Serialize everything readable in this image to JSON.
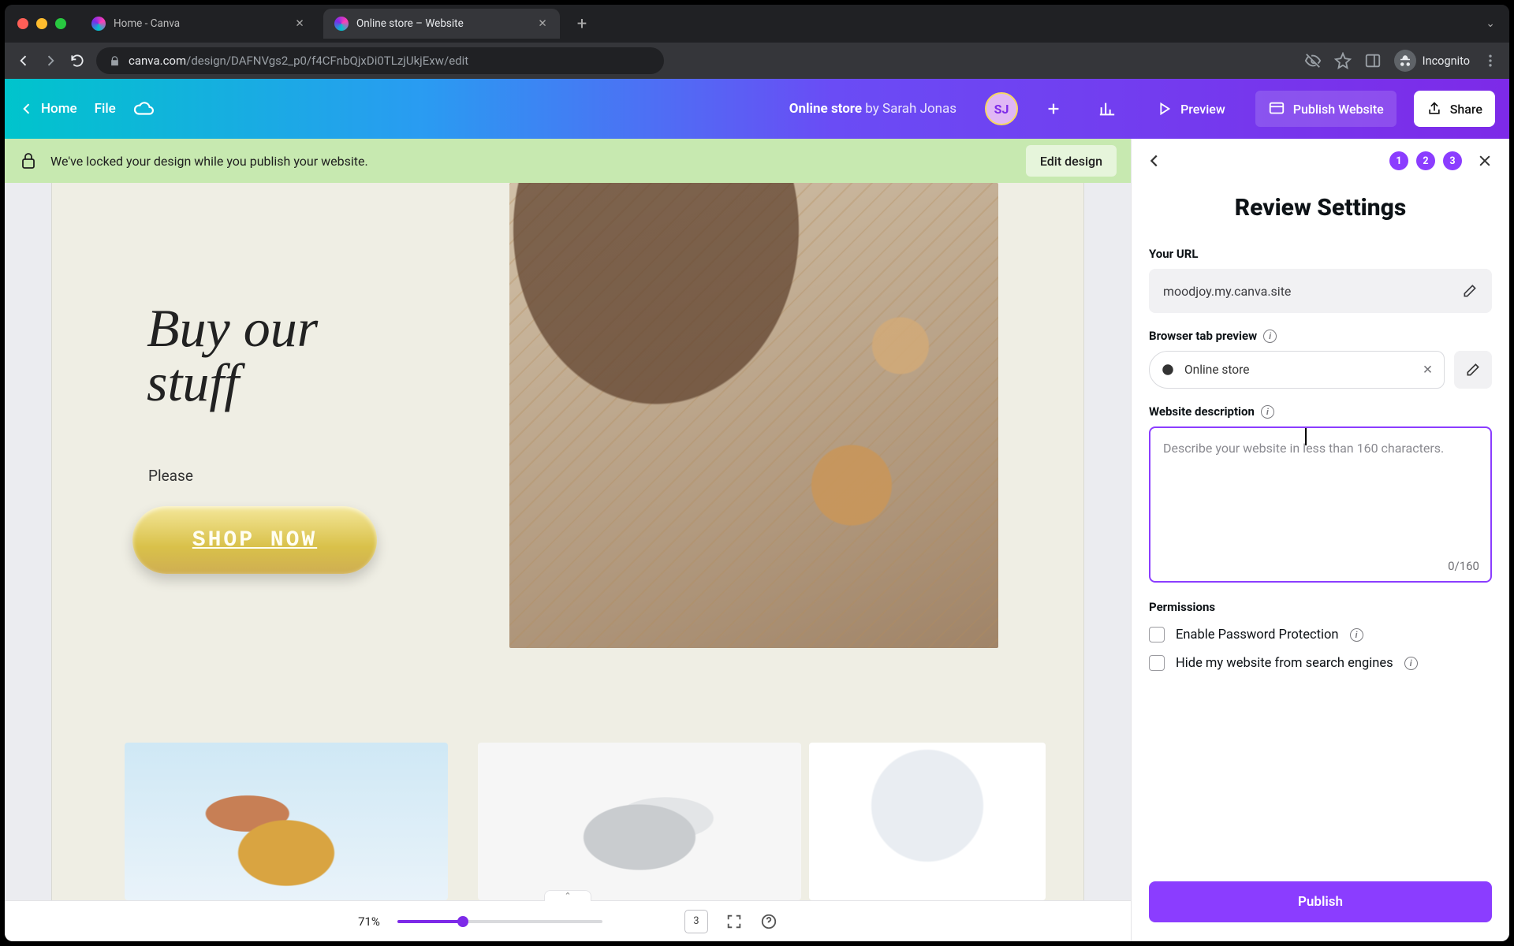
{
  "browser": {
    "tabs": [
      {
        "title": "Home - Canva",
        "active": false
      },
      {
        "title": "Online store – Website",
        "active": true
      }
    ],
    "url_display": {
      "host": "canva.com",
      "path": "/design/DAFNVgs2_p0/f4CFnbQjxDi0TLzjUkjExw/edit"
    },
    "incognito_label": "Incognito"
  },
  "header": {
    "home": "Home",
    "file": "File",
    "doc_title": "Online store",
    "by": "by Sarah Jonas",
    "avatar_initials": "SJ",
    "preview": "Preview",
    "publish": "Publish Website",
    "share": "Share"
  },
  "lockbar": {
    "message": "We've locked your design while you publish your website.",
    "edit": "Edit design"
  },
  "canvas": {
    "headline": "Buy our\nstuff",
    "subline": "Please",
    "shop_btn": "SHOP NOW"
  },
  "bottombar": {
    "zoom": "71%",
    "page_count": "3"
  },
  "panel": {
    "steps": [
      "1",
      "2",
      "3"
    ],
    "title": "Review Settings",
    "your_url_label": "Your URL",
    "your_url_value": "moodjoy.my.canva.site",
    "tab_preview_label": "Browser tab preview",
    "tab_preview_value": "Online store",
    "desc_label": "Website description",
    "desc_placeholder": "Describe your website in less than 160 characters.",
    "desc_count": "0/160",
    "permissions_label": "Permissions",
    "perm_password": "Enable Password Protection",
    "perm_hide": "Hide my website from search engines",
    "publish_btn": "Publish"
  }
}
